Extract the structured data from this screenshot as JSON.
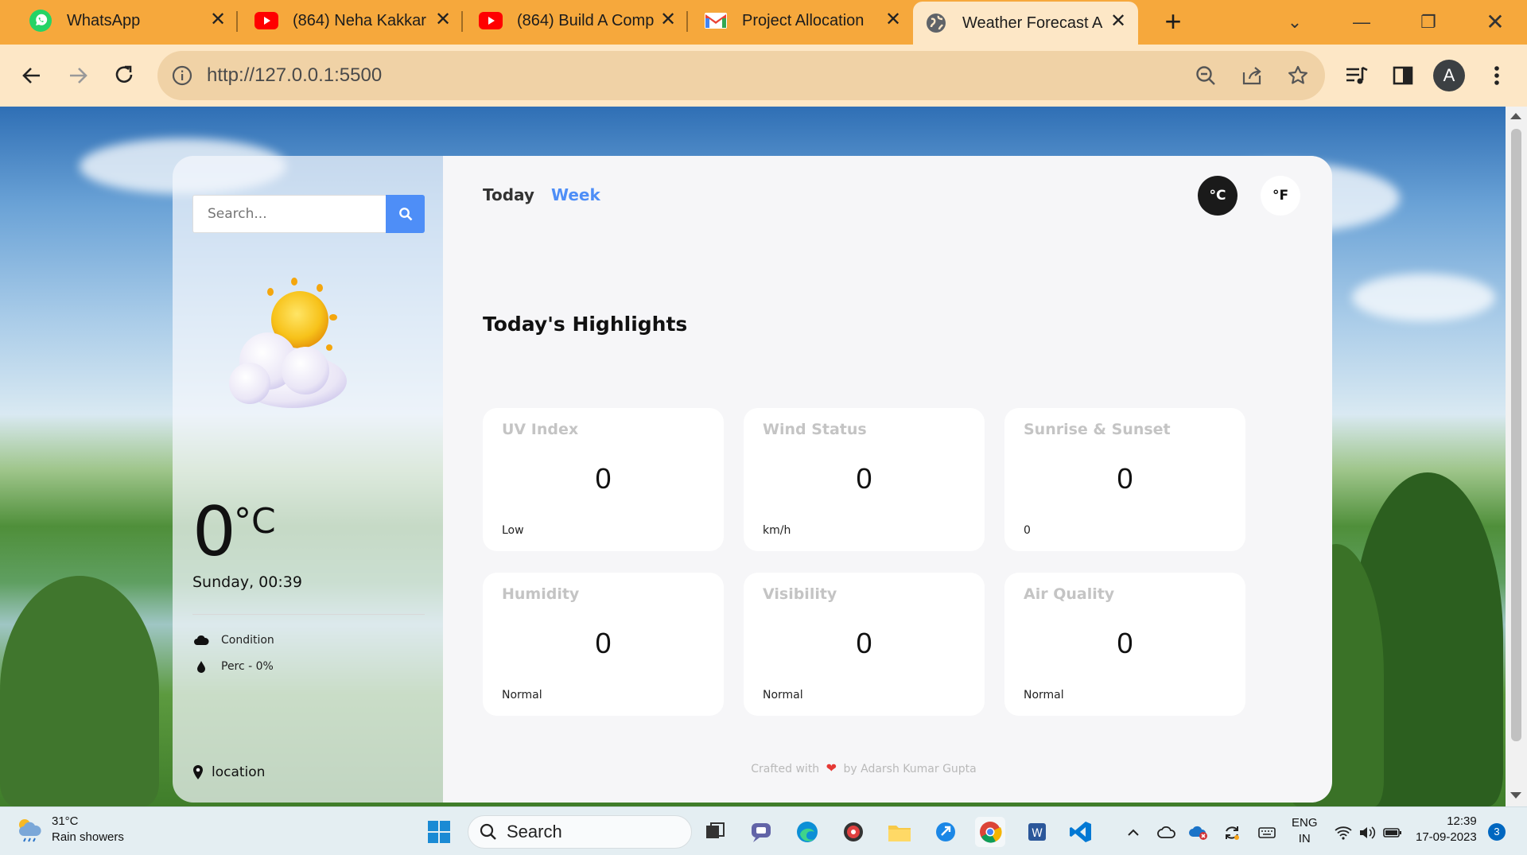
{
  "browser": {
    "tabs": [
      {
        "label": "WhatsApp",
        "icon": "whatsapp-icon"
      },
      {
        "label": "(864) Neha Kakkar",
        "icon": "youtube-icon"
      },
      {
        "label": "(864) Build A Comp",
        "icon": "youtube-icon"
      },
      {
        "label": "Project Allocation",
        "icon": "gmail-icon"
      },
      {
        "label": "Weather Forecast A",
        "icon": "globe-icon"
      }
    ],
    "url": "http://127.0.0.1:5500",
    "profile_initial": "A",
    "accent": "#f6a83c"
  },
  "sidebar": {
    "search_placeholder": "Search...",
    "temperature": "0",
    "temperature_unit": "°C",
    "date_time": "Sunday, 00:39",
    "condition": "Condition",
    "precipitation": "Perc - 0%",
    "location": "location"
  },
  "main": {
    "tab_today": "Today",
    "tab_week": "Week",
    "unit_c": "°C",
    "unit_f": "°F",
    "highlights_title": "Today's Highlights",
    "highlights": [
      {
        "title": "UV Index",
        "value": "0",
        "status": "Low"
      },
      {
        "title": "Wind Status",
        "value": "0",
        "status": "km/h"
      },
      {
        "title": "Sunrise & Sunset",
        "value": "0",
        "status": "0"
      },
      {
        "title": "Humidity",
        "value": "0",
        "status": "Normal"
      },
      {
        "title": "Visibility",
        "value": "0",
        "status": "Normal"
      },
      {
        "title": "Air Quality",
        "value": "0",
        "status": "Normal"
      }
    ],
    "footer_prefix": "Crafted with",
    "footer_suffix": "by Adarsh Kumar Gupta"
  },
  "taskbar": {
    "weather_temp": "31°C",
    "weather_desc": "Rain showers",
    "search_label": "Search",
    "lang_top": "ENG",
    "lang_bottom": "IN",
    "time": "12:39",
    "date": "17-09-2023",
    "notification_count": "3"
  }
}
